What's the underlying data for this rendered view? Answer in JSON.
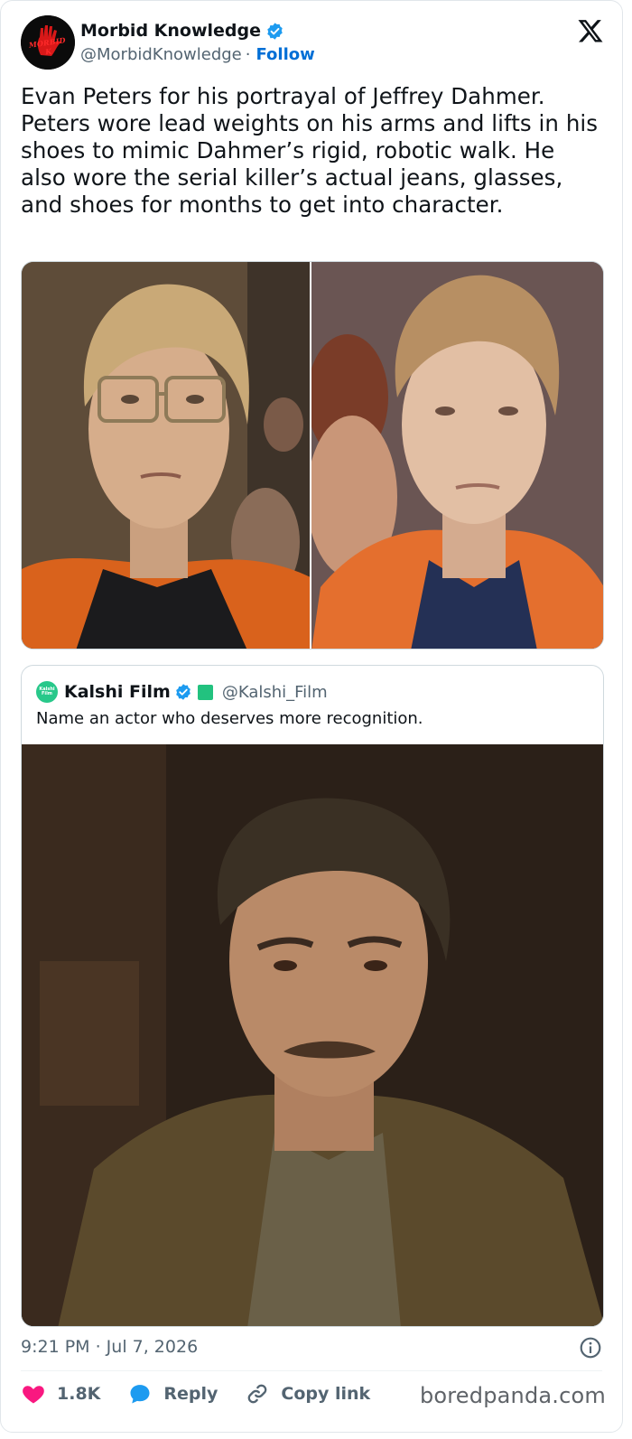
{
  "author": {
    "display_name": "Morbid Knowledge",
    "handle": "@MorbidKnowledge",
    "separator": "·",
    "follow_label": "Follow",
    "avatar_text": "MORBID K"
  },
  "tweet": {
    "text": "Evan Peters for his portrayal of Jeffrey Dahmer. Peters wore lead weights on his arms and lifts in his shoes to mimic Dahmer’s rigid, robotic walk. He also wore the serial killer’s actual jeans, glasses, and shoes for months to get into character."
  },
  "quote": {
    "display_name": "Kalshi Film",
    "handle": "@Kalshi_Film",
    "avatar_text": "Kalshi Film",
    "text": "Name an actor who deserves more recognition."
  },
  "footer": {
    "timestamp": "9:21 PM · Jul 7, 2026",
    "likes": "1.8K",
    "reply_label": "Reply",
    "copy_label": "Copy link"
  },
  "watermark": "boredpanda.com",
  "colors": {
    "verified": "#1d9bf0",
    "like": "#f91880",
    "reply": "#1d9bf0",
    "follow": "#006fd6"
  },
  "icons": [
    "x-logo-icon",
    "verified-badge-icon",
    "heart-icon",
    "reply-bubble-icon",
    "link-icon",
    "info-icon"
  ]
}
